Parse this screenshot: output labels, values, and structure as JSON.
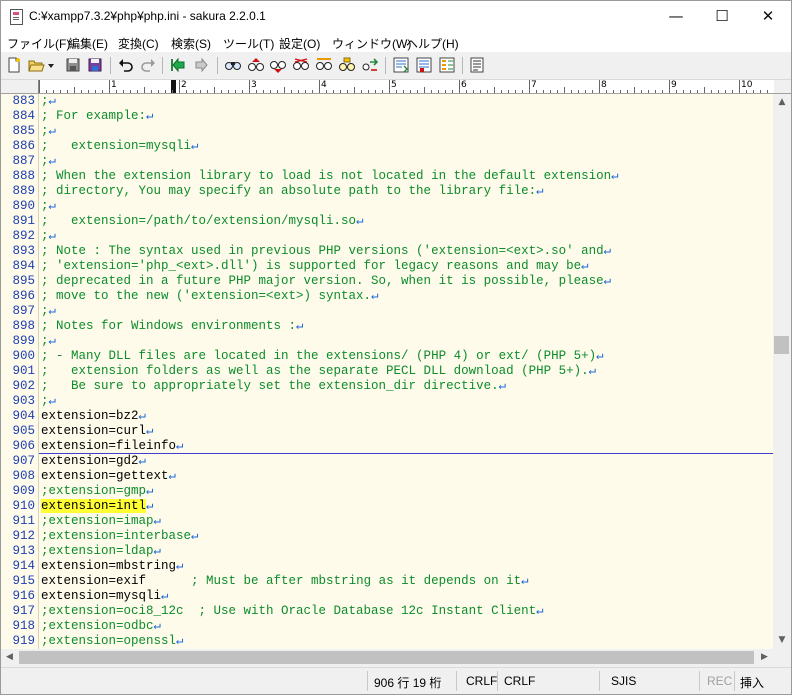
{
  "window": {
    "title": "C:¥xampp7.3.2¥php¥php.ini - sakura 2.2.0.1",
    "minimize_glyph": "—",
    "maximize_glyph": "☐",
    "close_glyph": "✕"
  },
  "menu": [
    "ファイル(F)",
    "編集(E)",
    "変換(C)",
    "検索(S)",
    "ツール(T)",
    "設定(O)",
    "ウィンドウ(W)",
    "ヘルプ(H)"
  ],
  "toolbar": {
    "icons": [
      "new-file-icon",
      "open-folder-icon",
      "dropdown-arrow-icon",
      "save-icon",
      "save-all-icon",
      "undo-icon",
      "redo-icon",
      "jump-back-icon",
      "jump-forward-icon",
      "search-icon",
      "search-prev-icon",
      "search-next-icon",
      "replace-icon",
      "search-box-icon",
      "grep-icon",
      "compare-icon",
      "grep-replace-icon",
      "mark-icon",
      "outline-icon"
    ]
  },
  "ruler": {
    "labels": [
      "1",
      "2",
      "3",
      "4",
      "5",
      "6",
      "7",
      "8",
      "9",
      "10"
    ]
  },
  "editor": {
    "eol_glyph": "↵",
    "lines": [
      {
        "num": "883",
        "text": ";",
        "kind": "comment"
      },
      {
        "num": "884",
        "text": "; For example:",
        "kind": "comment"
      },
      {
        "num": "885",
        "text": ";",
        "kind": "comment"
      },
      {
        "num": "886",
        "text": ";   extension=mysqli",
        "kind": "comment"
      },
      {
        "num": "887",
        "text": ";",
        "kind": "comment"
      },
      {
        "num": "888",
        "text": "; When the extension library to load is not located in the default extension",
        "kind": "comment"
      },
      {
        "num": "889",
        "text": "; directory, You may specify an absolute path to the library file:",
        "kind": "comment"
      },
      {
        "num": "890",
        "text": ";",
        "kind": "comment"
      },
      {
        "num": "891",
        "text": ";   extension=/path/to/extension/mysqli.so",
        "kind": "comment"
      },
      {
        "num": "892",
        "text": ";",
        "kind": "comment"
      },
      {
        "num": "893",
        "text": "; Note : The syntax used in previous PHP versions ('extension=<ext>.so' and",
        "kind": "comment"
      },
      {
        "num": "894",
        "text": "; 'extension='php_<ext>.dll') is supported for legacy reasons and may be",
        "kind": "comment"
      },
      {
        "num": "895",
        "text": "; deprecated in a future PHP major version. So, when it is possible, please",
        "kind": "comment"
      },
      {
        "num": "896",
        "text": "; move to the new ('extension=<ext>) syntax.",
        "kind": "comment"
      },
      {
        "num": "897",
        "text": ";",
        "kind": "comment"
      },
      {
        "num": "898",
        "text": "; Notes for Windows environments :",
        "kind": "comment"
      },
      {
        "num": "899",
        "text": ";",
        "kind": "comment"
      },
      {
        "num": "900",
        "text": "; - Many DLL files are located in the extensions/ (PHP 4) or ext/ (PHP 5+)",
        "kind": "comment"
      },
      {
        "num": "901",
        "text": ";   extension folders as well as the separate PECL DLL download (PHP 5+).",
        "kind": "comment"
      },
      {
        "num": "902",
        "text": ";   Be sure to appropriately set the extension_dir directive.",
        "kind": "comment"
      },
      {
        "num": "903",
        "text": ";",
        "kind": "comment"
      },
      {
        "num": "904",
        "text": "extension=bz2",
        "kind": "code"
      },
      {
        "num": "905",
        "text": "extension=curl",
        "kind": "code"
      },
      {
        "num": "906",
        "text": "extension=fileinfo",
        "kind": "code",
        "caret": true
      },
      {
        "num": "907",
        "text": "extension=gd2",
        "kind": "code"
      },
      {
        "num": "908",
        "text": "extension=gettext",
        "kind": "code"
      },
      {
        "num": "909",
        "text": ";extension=gmp",
        "kind": "comment"
      },
      {
        "num": "910",
        "text": "extension=intl",
        "kind": "code",
        "highlight": true
      },
      {
        "num": "911",
        "text": ";extension=imap",
        "kind": "comment"
      },
      {
        "num": "912",
        "text": ";extension=interbase",
        "kind": "comment"
      },
      {
        "num": "913",
        "text": ";extension=ldap",
        "kind": "comment"
      },
      {
        "num": "914",
        "text": "extension=mbstring",
        "kind": "code"
      },
      {
        "num": "915",
        "text": "extension=exif",
        "kind": "code",
        "trail": "      ; Must be after mbstring as it depends on it"
      },
      {
        "num": "916",
        "text": "extension=mysqli",
        "kind": "code"
      },
      {
        "num": "917",
        "text": ";extension=oci8_12c  ; Use with Oracle Database 12c Instant Client",
        "kind": "comment"
      },
      {
        "num": "918",
        "text": ";extension=odbc",
        "kind": "comment"
      },
      {
        "num": "919",
        "text": ";extension=openssl",
        "kind": "comment"
      }
    ]
  },
  "scrollbar": {
    "up_glyph": "▲",
    "down_glyph": "▼",
    "left_glyph": "◀",
    "right_glyph": "▶"
  },
  "status": {
    "position": "906 行   19 桁",
    "eol1": "CRLF",
    "eol2": "CRLF",
    "encoding": "SJIS",
    "rec": "REC",
    "mode": "挿入"
  }
}
